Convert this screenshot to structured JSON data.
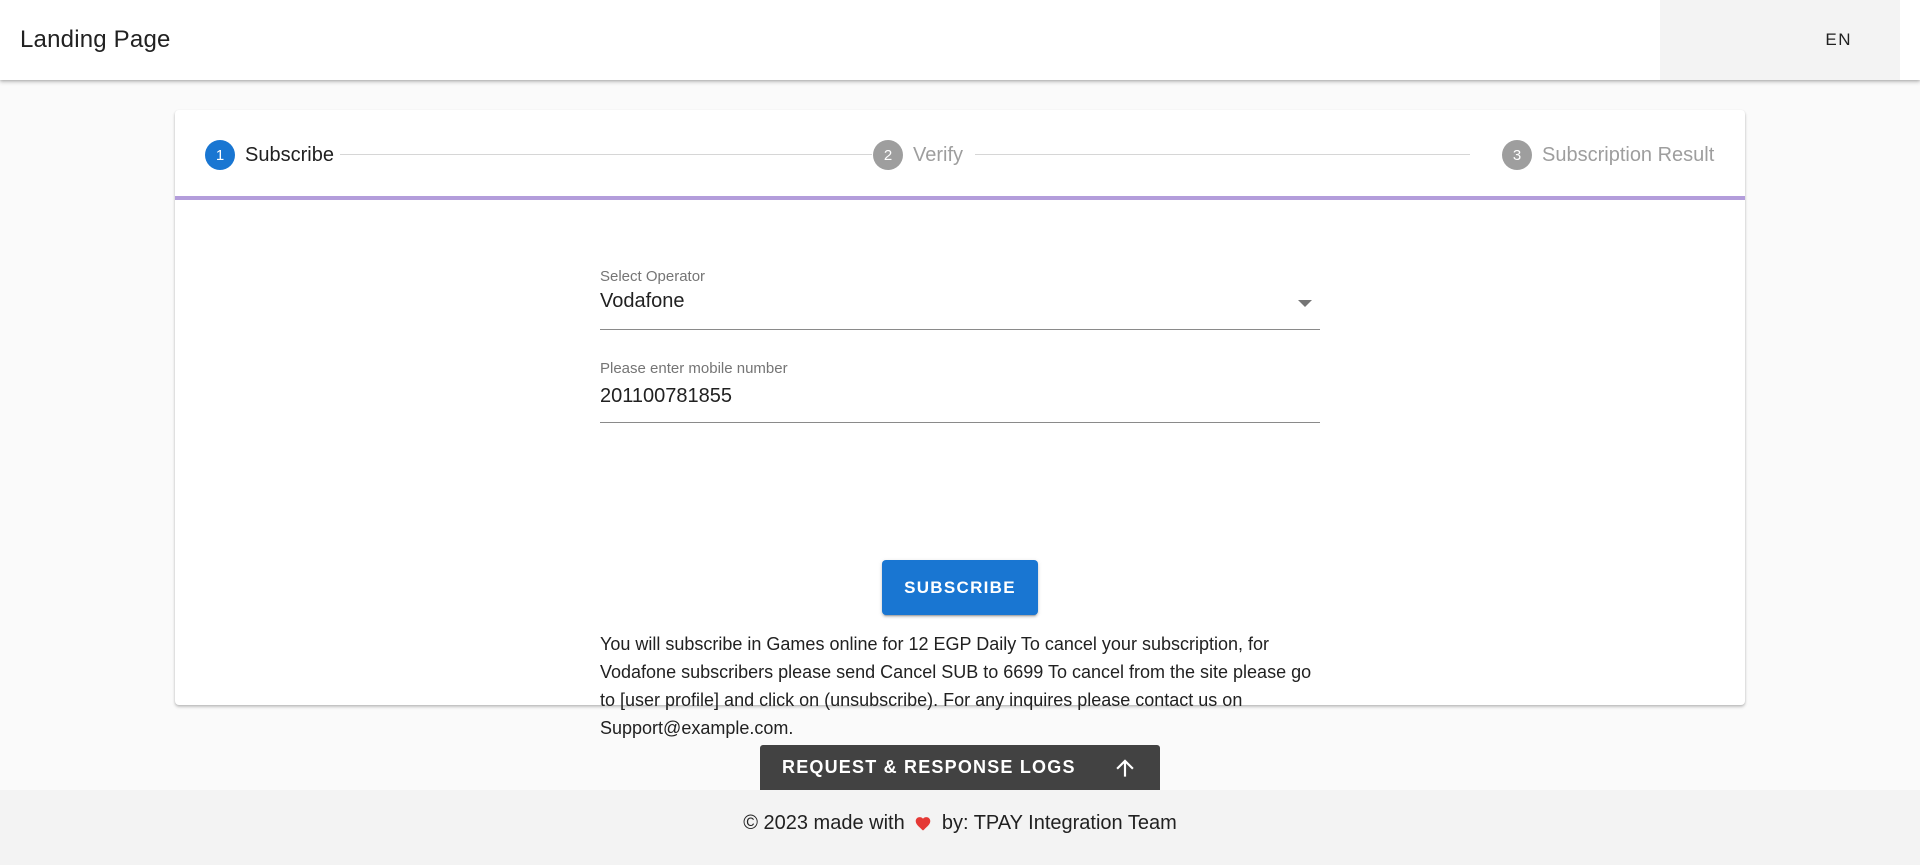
{
  "header": {
    "title": "Landing Page",
    "language": "EN"
  },
  "stepper": {
    "steps": [
      {
        "number": "1",
        "label": "Subscribe",
        "state": "active"
      },
      {
        "number": "2",
        "label": "Verify",
        "state": "inactive"
      },
      {
        "number": "3",
        "label": "Subscription Result",
        "state": "inactive"
      }
    ]
  },
  "form": {
    "operator": {
      "label": "Select Operator",
      "value": "Vodafone"
    },
    "mobile": {
      "label": "Please enter mobile number",
      "value": "201100781855"
    },
    "subscribe_label": "Subscribe",
    "terms": "You will subscribe in Games online for 12 EGP Daily To cancel your subscription, for Vodafone subscribers please send Cancel SUB to 6699 To cancel from the site please go to [user profile] and click on (unsubscribe). For any inquires please contact us on Support@example.com."
  },
  "logs": {
    "label": "REQUEST & RESPONSE LOGS",
    "icon": "arrow-up-icon"
  },
  "footer": {
    "prefix": "© 2023 made with",
    "suffix": "by: TPAY Integration Team",
    "icon": "heart-icon"
  },
  "colors": {
    "primary": "#1976d2",
    "inactive_step": "#9e9e9e",
    "stepper_underline": "#b39ddb",
    "logs_bar": "#424242",
    "heart": "#e53935"
  }
}
